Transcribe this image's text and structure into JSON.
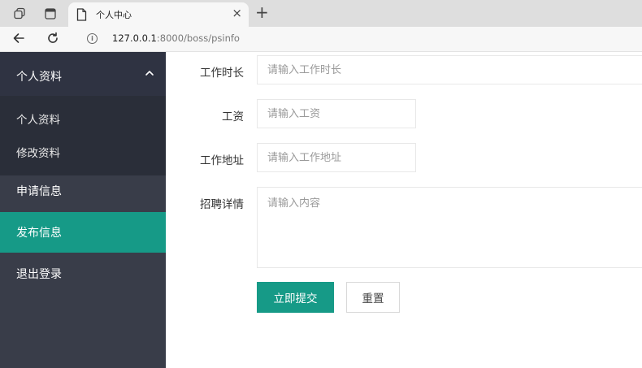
{
  "browser": {
    "tab_title": "个人中心",
    "tab_close": "×",
    "new_tab": "+",
    "url_host": "127.0.0.1",
    "url_path": ":8000/boss/psinfo"
  },
  "sidebar": {
    "group_title": "个人资料",
    "group_expanded": true,
    "sub_items": [
      {
        "label": "个人资料"
      },
      {
        "label": "修改资料"
      }
    ],
    "items": [
      {
        "label": "申请信息",
        "active": false
      },
      {
        "label": "发布信息",
        "active": true
      },
      {
        "label": "退出登录",
        "active": false
      }
    ]
  },
  "form": {
    "work_duration": {
      "label": "工作时长",
      "value": "",
      "placeholder": "请输入工作时长"
    },
    "salary": {
      "label": "工资",
      "value": "",
      "placeholder": "请输入工资"
    },
    "work_address": {
      "label": "工作地址",
      "value": "",
      "placeholder": "请输入工作地址"
    },
    "job_details": {
      "label": "招聘详情",
      "value": "",
      "placeholder": "请输入内容"
    },
    "submit_label": "立即提交",
    "reset_label": "重置"
  },
  "colors": {
    "accent": "#169a87",
    "sidebar_bg": "#393d49",
    "sidebar_header_bg": "#2f3342",
    "sidebar_sub_bg": "#2a2e39"
  },
  "icons": {
    "workspaces": "workspaces-icon",
    "tab_actions": "tab-actions-icon",
    "page": "page-icon",
    "back": "back-arrow-icon",
    "reload": "reload-icon",
    "info": "info-icon",
    "collapse": "chevron-up-icon"
  }
}
